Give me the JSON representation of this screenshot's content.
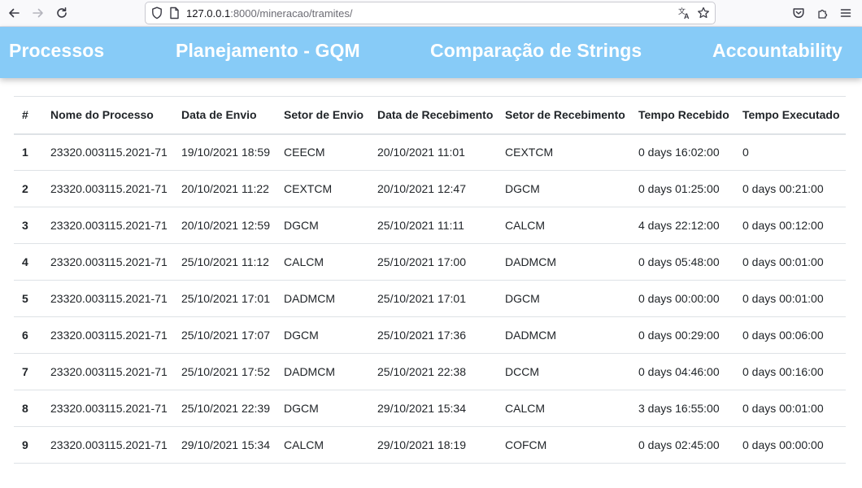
{
  "browser": {
    "url_host": "127.0.0.1",
    "url_rest": ":8000/mineracao/tramites/"
  },
  "nav": {
    "items": [
      "Processos",
      "Planejamento - GQM",
      "Comparação de Strings",
      "Accountability"
    ]
  },
  "table": {
    "headers": [
      "#",
      "Nome do Processo",
      "Data de Envio",
      "Setor de Envio",
      "Data de Recebimento",
      "Setor de Recebimento",
      "Tempo Recebido",
      "Tempo Executado"
    ],
    "rows": [
      [
        "1",
        "23320.003115.2021-71",
        "19/10/2021 18:59",
        "CEECM",
        "20/10/2021 11:01",
        "CEXTCM",
        "0 days 16:02:00",
        "0"
      ],
      [
        "2",
        "23320.003115.2021-71",
        "20/10/2021 11:22",
        "CEXTCM",
        "20/10/2021 12:47",
        "DGCM",
        "0 days 01:25:00",
        "0 days 00:21:00"
      ],
      [
        "3",
        "23320.003115.2021-71",
        "20/10/2021 12:59",
        "DGCM",
        "25/10/2021 11:11",
        "CALCM",
        "4 days 22:12:00",
        "0 days 00:12:00"
      ],
      [
        "4",
        "23320.003115.2021-71",
        "25/10/2021 11:12",
        "CALCM",
        "25/10/2021 17:00",
        "DADMCM",
        "0 days 05:48:00",
        "0 days 00:01:00"
      ],
      [
        "5",
        "23320.003115.2021-71",
        "25/10/2021 17:01",
        "DADMCM",
        "25/10/2021 17:01",
        "DGCM",
        "0 days 00:00:00",
        "0 days 00:01:00"
      ],
      [
        "6",
        "23320.003115.2021-71",
        "25/10/2021 17:07",
        "DGCM",
        "25/10/2021 17:36",
        "DADMCM",
        "0 days 00:29:00",
        "0 days 00:06:00"
      ],
      [
        "7",
        "23320.003115.2021-71",
        "25/10/2021 17:52",
        "DADMCM",
        "25/10/2021 22:38",
        "DCCM",
        "0 days 04:46:00",
        "0 days 00:16:00"
      ],
      [
        "8",
        "23320.003115.2021-71",
        "25/10/2021 22:39",
        "DGCM",
        "29/10/2021 15:34",
        "CALCM",
        "3 days 16:55:00",
        "0 days 00:01:00"
      ],
      [
        "9",
        "23320.003115.2021-71",
        "29/10/2021 15:34",
        "CALCM",
        "29/10/2021 18:19",
        "COFCM",
        "0 days 02:45:00",
        "0 days 00:00:00"
      ]
    ]
  },
  "colors": {
    "navbar": "#87cbf7",
    "nav_text": "#ffffff",
    "table_border": "#dee2e6"
  },
  "icons": [
    "back-arrow-icon",
    "forward-arrow-icon",
    "reload-icon",
    "shield-icon",
    "page-icon",
    "translate-icon",
    "bookmark-star-icon",
    "pocket-icon",
    "extensions-icon",
    "menu-icon"
  ]
}
